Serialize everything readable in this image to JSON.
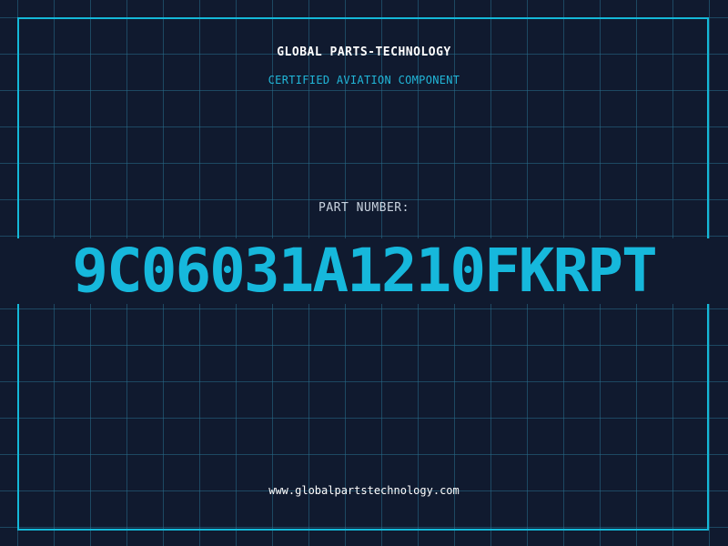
{
  "label": {
    "company": "GLOBAL PARTS-TECHNOLOGY",
    "subtitle": "CERTIFIED AVIATION COMPONENT",
    "part_number_label": "PART NUMBER:",
    "part_number": "9C06031A1210FKRPT",
    "website": "www.globalpartstechnology.com"
  },
  "colors": {
    "background": "#101a2f",
    "grid": "#286e8c",
    "accent": "#16b8dc",
    "text": "#ffffff"
  }
}
